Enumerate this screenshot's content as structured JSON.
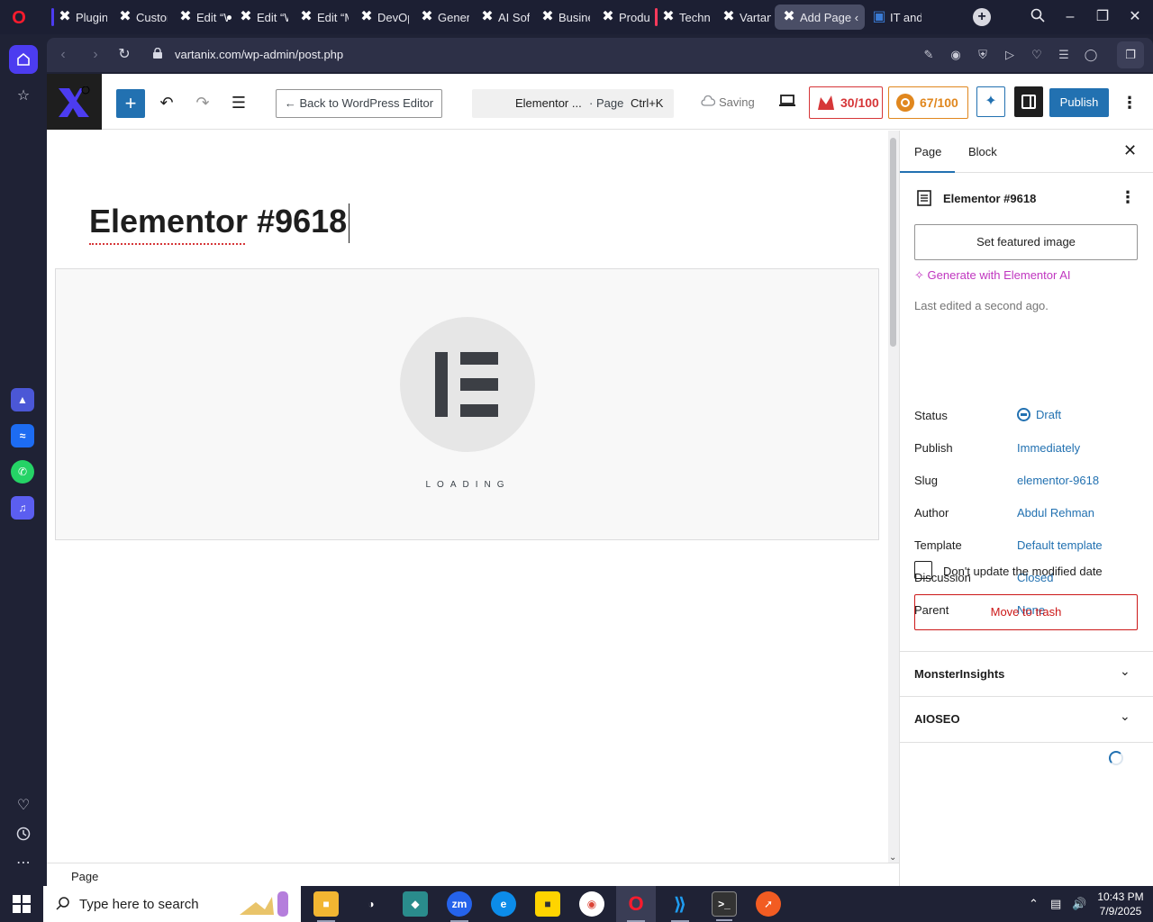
{
  "browser": {
    "tabs": [
      {
        "label": "Plugins",
        "marker": "blue"
      },
      {
        "label": "Custom"
      },
      {
        "label": "Edit “W",
        "dot": true
      },
      {
        "label": "Edit “W"
      },
      {
        "label": "Edit “M"
      },
      {
        "label": "DevOp"
      },
      {
        "label": "Genera"
      },
      {
        "label": "AI Soft"
      },
      {
        "label": "Busine"
      },
      {
        "label": "Produc"
      },
      {
        "label": "Techno",
        "marker": "red"
      },
      {
        "label": "Vartani"
      },
      {
        "label": "Add Page ‹ V",
        "active": true
      },
      {
        "label": "IT and"
      }
    ],
    "url": "vartanix.com/wp-admin/post.php"
  },
  "toolbar": {
    "back_label": "← Back to WordPress Editor",
    "command_title": "Elementor ...",
    "command_type": "· Page",
    "command_shortcut": "Ctrl+K",
    "saving_label": "Saving",
    "score_seo": "30/100",
    "score_readability": "67/100",
    "publish_label": "Publish"
  },
  "canvas": {
    "title": "Elementor #9618",
    "loading_label": "LOADING"
  },
  "breadcrumb": {
    "label": "Page"
  },
  "settings": {
    "tab_page": "Page",
    "tab_block": "Block",
    "doc_title": "Elementor #9618",
    "featured_label": "Set featured image",
    "generate_label": "Generate with Elementor AI",
    "last_edited": "Last edited a second ago.",
    "rows": [
      {
        "key": "Status",
        "value": "Draft"
      },
      {
        "key": "Publish",
        "value": "Immediately"
      },
      {
        "key": "Slug",
        "value": "elementor-9618"
      },
      {
        "key": "Author",
        "value": "Abdul Rehman"
      },
      {
        "key": "Template",
        "value": "Default template"
      },
      {
        "key": "Discussion",
        "value": "Closed"
      },
      {
        "key": "Parent",
        "value": "None"
      }
    ],
    "checkbox_label": "Don't update the modified date",
    "trash_label": "Move to trash",
    "panel_monsterinsights": "MonsterInsights",
    "panel_aioseo": "AIOSEO"
  },
  "taskbar": {
    "search_placeholder": "Type here to search",
    "time": "10:43 PM",
    "date": "7/9/2025"
  },
  "colors": {
    "accent": "#2271b1",
    "danger": "#cc1818",
    "opera_active": "#4c3cf0"
  }
}
